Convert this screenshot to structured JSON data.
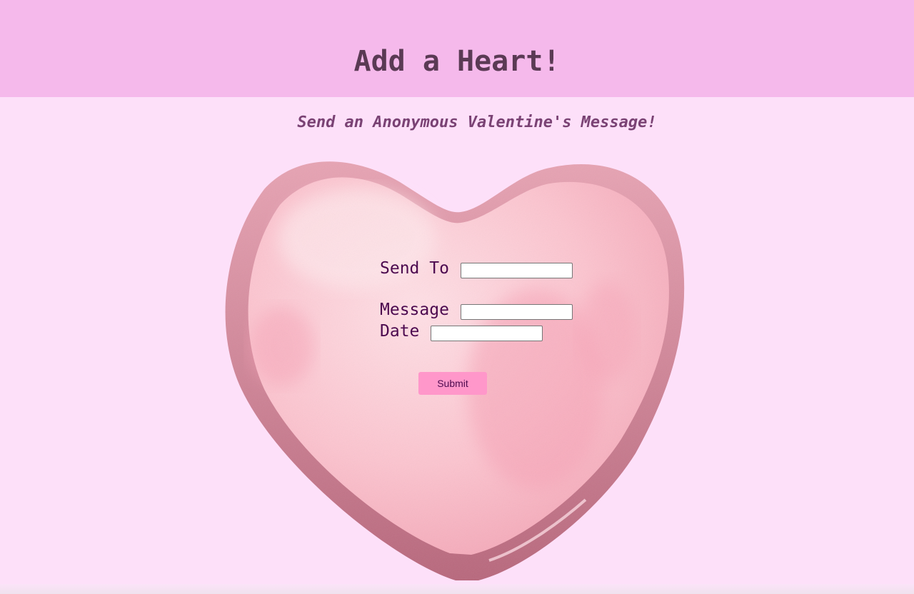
{
  "header": {
    "title": "Add a Heart!"
  },
  "subtitle": "Send an Anonymous Valentine's Message!",
  "form": {
    "send_to_label": "Send To",
    "send_to_value": "",
    "message_label": "Message",
    "message_value": "",
    "date_label": "Date",
    "date_value": "",
    "submit_label": "Submit"
  },
  "colors": {
    "page_background": "#fde0f9",
    "header_background": "#f5b9eb",
    "title_text": "#5a3a54",
    "subtitle_text": "#7a4274",
    "label_text": "#4c0a4f",
    "submit_background": "#ff97ca"
  },
  "images": {
    "heart": "candy-heart-illustration"
  }
}
